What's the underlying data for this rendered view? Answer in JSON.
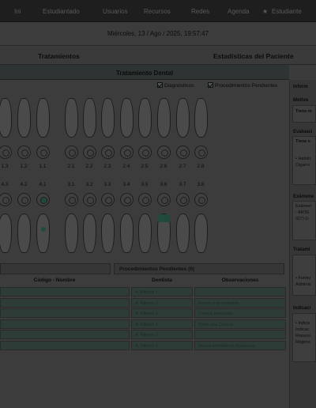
{
  "nav": {
    "items": [
      "Ini",
      "Estudiantado",
      "Usuarios",
      "Recursos",
      "Redes",
      "Agenda"
    ],
    "active_item": "Estudiante"
  },
  "datetime": "Miércoles, 13 / Ago / 2025, 19:57:47",
  "tabs": {
    "tratamientos": "Tratamientos",
    "estadisticas": "Estadísticas del Paciente"
  },
  "dental": {
    "title": "Tratamiento Dental",
    "check_diagnosticos": "Diagnósticos",
    "check_pendientes": "Procedimientos Pendientes",
    "upper_numbers": [
      "1.3",
      "1.2",
      "1.1",
      "2.1",
      "2.2",
      "2.3",
      "2.4",
      "2.5",
      "2.6",
      "2.7",
      "2.8"
    ],
    "lower_numbers": [
      "4.3",
      "4.2",
      "4.1",
      "3.1",
      "3.2",
      "3.3",
      "3.4",
      "3.5",
      "3.6",
      "3.7",
      "3.8"
    ]
  },
  "subtabs": {
    "first": "",
    "pendientes": "Procedimientos Pendientes (0)"
  },
  "table": {
    "headers": [
      "Código - Nombre",
      "Dentista",
      "Observaciones"
    ],
    "rows": [
      {
        "code": "",
        "dentist": "A. Ribeiro J.",
        "obs": ""
      },
      {
        "code": "",
        "dentist": "A. Ribeiro J.",
        "obs": "Resina mal realizada"
      },
      {
        "code": "",
        "dentist": "A. Ribeiro J.",
        "obs": "Corona Realizada"
      },
      {
        "code": "",
        "dentist": "A. Ribeiro J.",
        "obs": "Tiene una Corona"
      },
      {
        "code": "",
        "dentist": "A. Ribeiro J.",
        "obs": ""
      },
      {
        "code": "",
        "dentist": "A. Ribeiro J.",
        "obs": "Nueva endodoncia Realizada"
      }
    ]
  },
  "right": {
    "title": "Inform",
    "motivo_label": "Motivo",
    "motivo_text": "Tiene m",
    "evaluacion_label": "Evaluaci",
    "evaluacion_text": "Tiene s",
    "evaluacion_note1": "• Habito",
    "evaluacion_note2": "Cigarro",
    "examenes_label": "Exámene",
    "examenes_text1": "Exámen",
    "examenes_text2": "- ARTE",
    "examenes_text3": "027) 0-",
    "tratamiento_label": "Tratami",
    "tratamiento_text1": "• Formu",
    "tratamiento_text2": "Adminis",
    "indicaciones_label": "Indicaci",
    "indicaciones_text1": "• Indica",
    "indicaciones_text2": "Indicac",
    "indicaciones_text3": "Reposo",
    "indicaciones_text4": "Régime"
  },
  "colors": {
    "filled_marker": "#1f4a3c",
    "table_cell": "#2d3c37"
  }
}
